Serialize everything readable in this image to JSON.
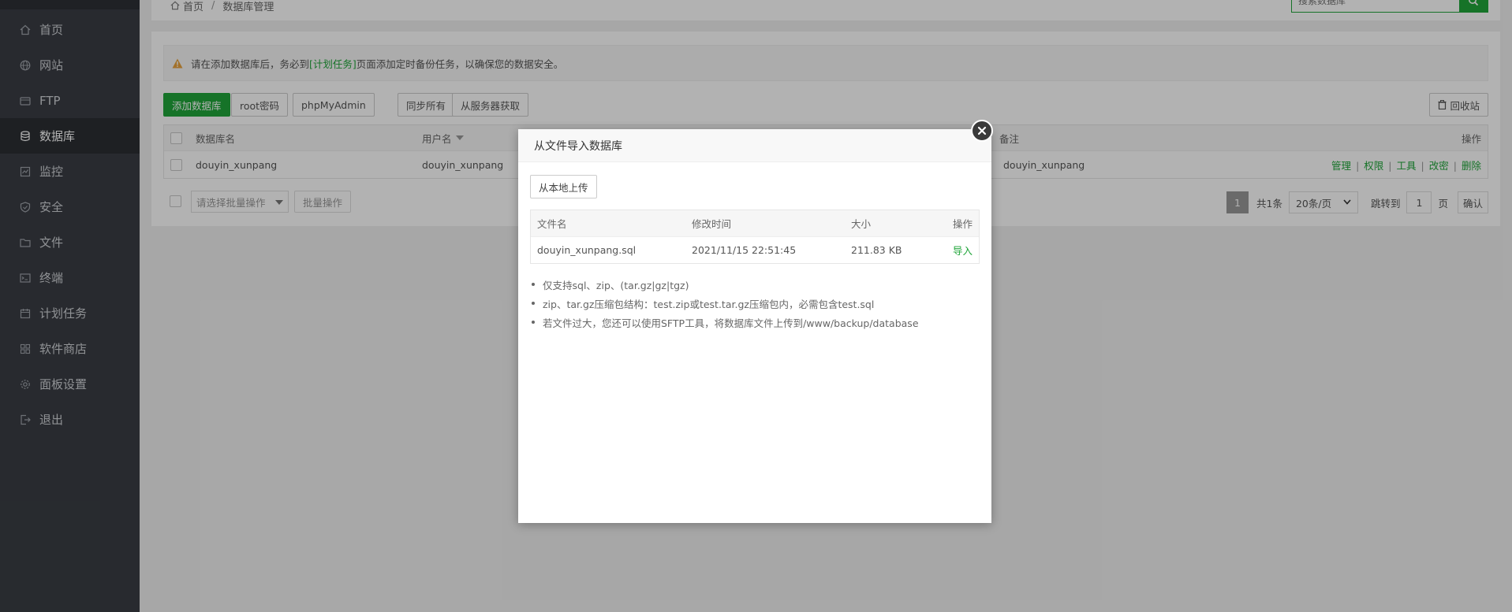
{
  "sidebar": {
    "items": [
      {
        "label": "首页",
        "icon": "home-icon"
      },
      {
        "label": "网站",
        "icon": "globe-icon"
      },
      {
        "label": "FTP",
        "icon": "ftp-icon"
      },
      {
        "label": "数据库",
        "icon": "database-icon",
        "active": true
      },
      {
        "label": "监控",
        "icon": "monitor-icon"
      },
      {
        "label": "安全",
        "icon": "shield-icon"
      },
      {
        "label": "文件",
        "icon": "folder-icon"
      },
      {
        "label": "终端",
        "icon": "terminal-icon"
      },
      {
        "label": "计划任务",
        "icon": "calendar-icon"
      },
      {
        "label": "软件商店",
        "icon": "apps-icon"
      },
      {
        "label": "面板设置",
        "icon": "gear-icon"
      },
      {
        "label": "退出",
        "icon": "logout-icon"
      }
    ]
  },
  "breadcrumb": {
    "home": "首页",
    "sep": "/",
    "current": "数据库管理"
  },
  "search": {
    "placeholder": "搜索数据库"
  },
  "alert": {
    "prefix": "请在添加数据库后，务必到",
    "link": "[计划任务]",
    "suffix": "页面添加定时备份任务，以确保您的数据安全。"
  },
  "toolbar": {
    "add_db": "添加数据库",
    "root_pwd": "root密码",
    "phpmyadmin": "phpMyAdmin",
    "sync_all": "同步所有",
    "fetch_server": "从服务器获取",
    "recycle": "回收站"
  },
  "table": {
    "headers": {
      "name": "数据库名",
      "user": "用户名",
      "remark": "备注",
      "ops": "操作"
    },
    "rows": [
      {
        "name": "douyin_xunpang",
        "user": "douyin_xunpang",
        "remark": "douyin_xunpang"
      }
    ],
    "row_ops": [
      "管理",
      "权限",
      "工具",
      "改密",
      "删除"
    ]
  },
  "footer": {
    "batch_placeholder": "请选择批量操作",
    "batch_btn": "批量操作",
    "page_current": "1",
    "total": "共1条",
    "per_page": "20条/页",
    "jump_label": "跳转到",
    "jump_value": "1",
    "page_unit": "页",
    "confirm": "确认"
  },
  "modal": {
    "title": "从文件导入数据库",
    "upload_btn": "从本地上传",
    "headers": {
      "file": "文件名",
      "mtime": "修改时间",
      "size": "大小",
      "op": "操作"
    },
    "files": [
      {
        "file": "douyin_xunpang.sql",
        "mtime": "2021/11/15 22:51:45",
        "size": "211.83 KB",
        "op": "导入"
      }
    ],
    "tips": [
      "仅支持sql、zip、(tar.gz|gz|tgz)",
      "zip、tar.gz压缩包结构：test.zip或test.tar.gz压缩包内，必需包含test.sql",
      "若文件过大，您还可以使用SFTP工具，将数据库文件上传到/www/backup/database"
    ]
  },
  "colors": {
    "accent": "#20a53a",
    "sidebar": "#3a3d44",
    "warning": "#e8a33d"
  }
}
